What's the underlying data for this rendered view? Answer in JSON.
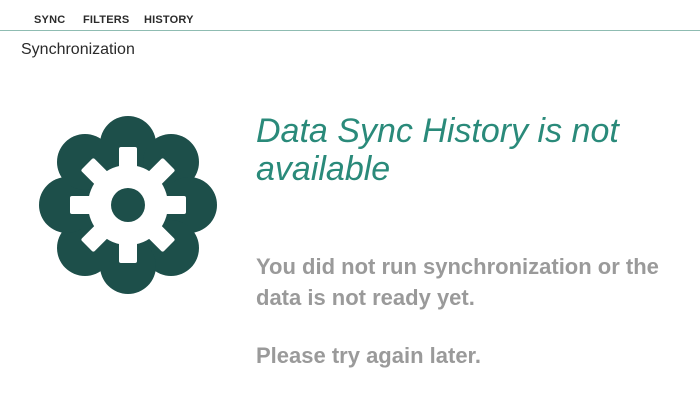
{
  "tabs": [
    {
      "label": "SYNC"
    },
    {
      "label": "FILTERS"
    },
    {
      "label": "HISTORY"
    }
  ],
  "page": {
    "title": "Synchronization"
  },
  "empty_state": {
    "icon": "gear-flower-icon",
    "heading": "Data Sync History is not available",
    "message": "You did not run synchronization or the data is not ready yet.",
    "retry": "Please try again later."
  },
  "colors": {
    "accent": "#2a8a7a",
    "icon": "#1d4f4a",
    "muted_text": "#9a9a9a",
    "tab_underline": "#8fbcb2"
  }
}
